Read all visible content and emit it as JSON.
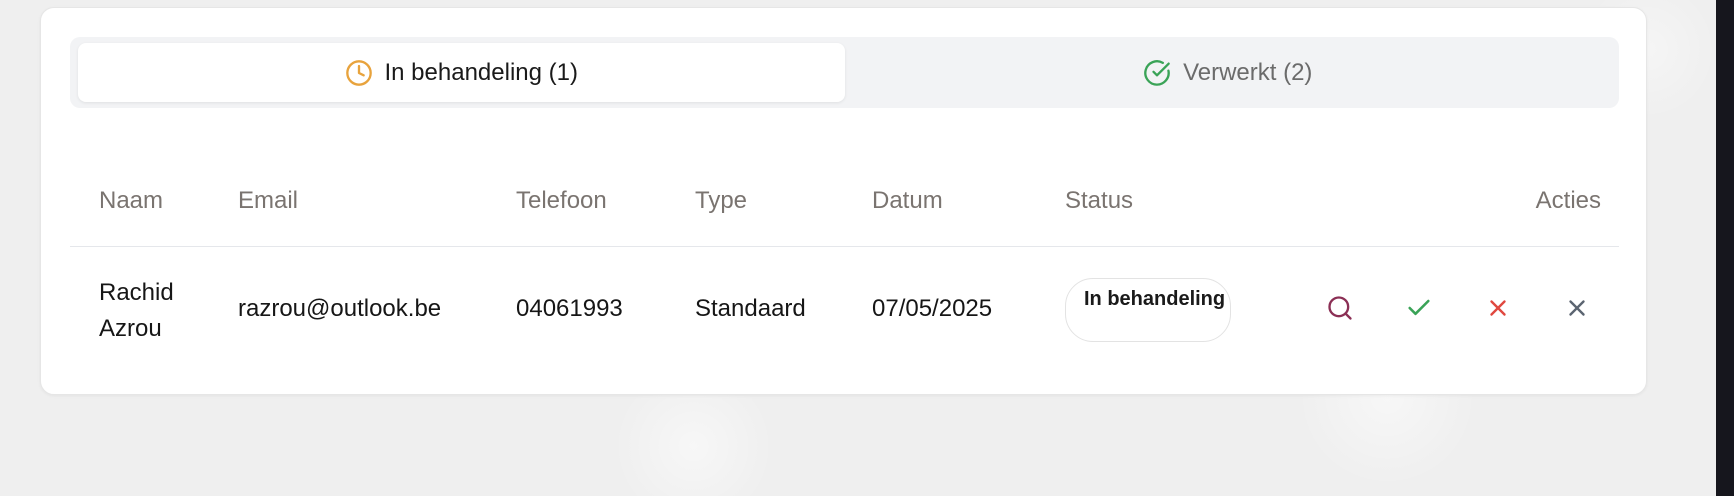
{
  "tabs": [
    {
      "label": "In behandeling (1)",
      "icon": "clock-icon",
      "icon_color": "#e8a33d",
      "active": true
    },
    {
      "label": "Verwerkt (2)",
      "icon": "check-circle-icon",
      "icon_color": "#3aa357",
      "active": false
    }
  ],
  "table": {
    "headers": [
      "Naam",
      "Email",
      "Telefoon",
      "Type",
      "Datum",
      "Status",
      "Acties"
    ],
    "rows": [
      {
        "name": "Rachid Azrou",
        "email": "razrou@outlook.be",
        "phone": "04061993",
        "type": "Standaard",
        "date": "07/05/2025",
        "status": "In behandeling",
        "actions": [
          {
            "icon": "search-icon",
            "color": "#8b2f55"
          },
          {
            "icon": "check-icon",
            "color": "#3aa357"
          },
          {
            "icon": "reject-icon",
            "color": "#e0483f"
          },
          {
            "icon": "close-icon",
            "color": "#5b6470"
          }
        ]
      }
    ]
  }
}
